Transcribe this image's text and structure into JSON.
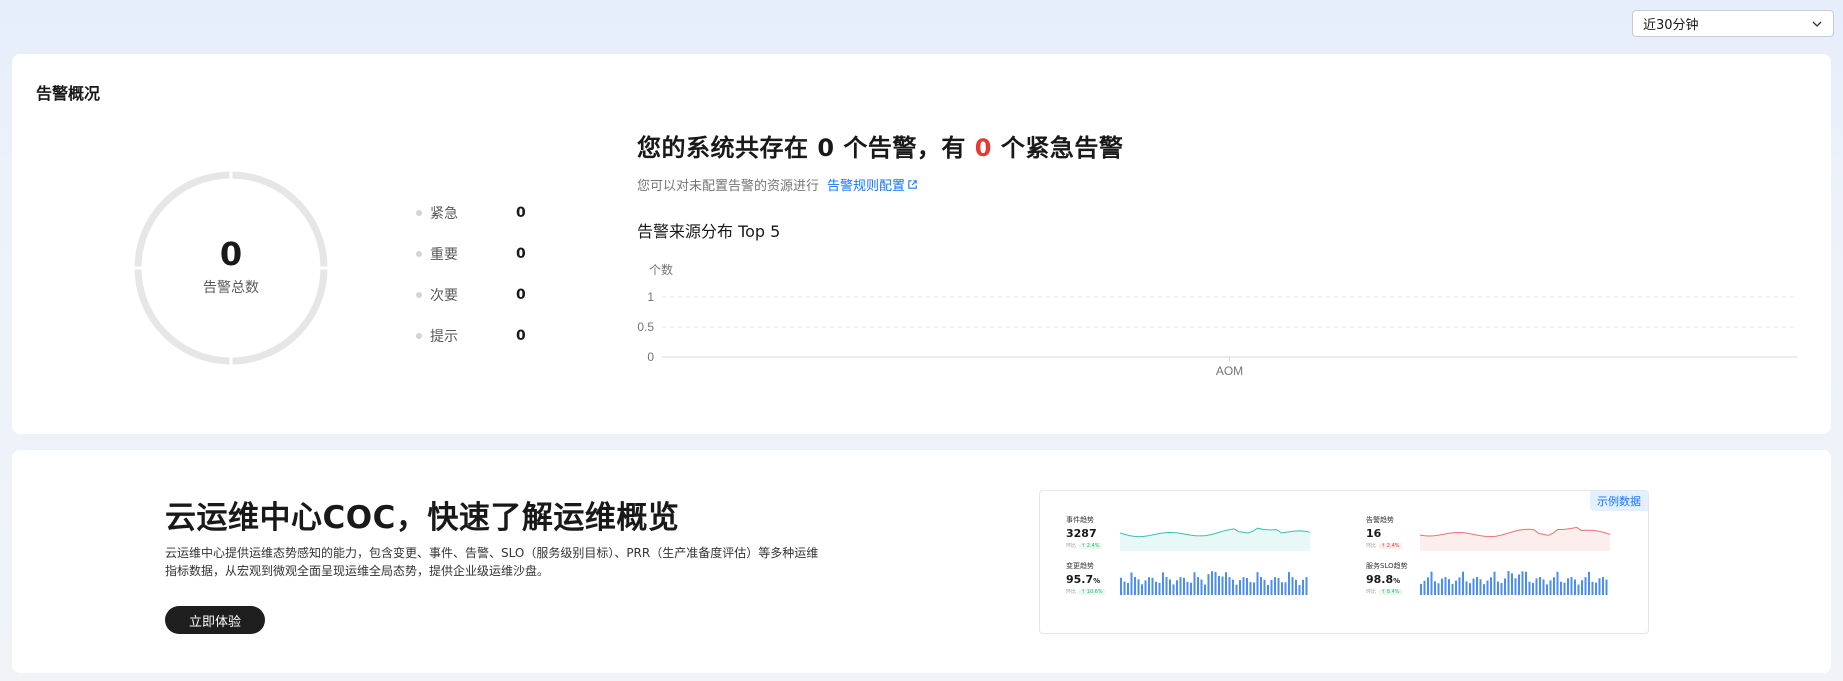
{
  "time_range": {
    "value": "近30分钟"
  },
  "alarm_overview": {
    "title": "告警概况",
    "total": {
      "value": "0",
      "label": "告警总数"
    },
    "levels": [
      {
        "label": "紧急",
        "value": "0"
      },
      {
        "label": "重要",
        "value": "0"
      },
      {
        "label": "次要",
        "value": "0"
      },
      {
        "label": "提示",
        "value": "0"
      }
    ],
    "headline": {
      "part1": "您的系统共存在 ",
      "count": "0",
      "part2": " 个告警，有 ",
      "urgent": "0",
      "part3": " 个紧急告警"
    },
    "subline": {
      "text": "您可以对未配置告警的资源进行",
      "link": "告警规则配置"
    },
    "top5_title": "告警来源分布 Top 5"
  },
  "chart_data": {
    "type": "bar",
    "ylabel": "个数",
    "yticks": [
      "1",
      "0.5",
      "0"
    ],
    "categories": [
      "AOM"
    ],
    "values": [
      0
    ],
    "ylim": [
      0,
      1
    ],
    "grid": true
  },
  "promo": {
    "title": "云运维中心COC，快速了解运维概览",
    "desc_line1": "云运维中心提供运维态势感知的能力，包含变更、事件、告警、SLO（服务级别目标）、PRR（生产准备度评估）等多种运维",
    "desc_line2": "指标数据，从宏观到微观全面呈现运维全局态势，提供企业级运维沙盘。",
    "button": "立即体验",
    "sample_tag": "示例数据",
    "minis": [
      {
        "title": "事件趋势",
        "value": "3287",
        "unit": "",
        "sub": "环比",
        "tag": "↑ 2.4%",
        "color": "#36c2b4"
      },
      {
        "title": "告警趋势",
        "value": "16",
        "unit": "",
        "sub": "环比",
        "tag": "↑ 2.4%",
        "color": "#f07070"
      },
      {
        "title": "变更趋势",
        "value": "95.7",
        "unit": "%",
        "sub": "环比",
        "tag": "↑ 10.6%",
        "color": "#4a8ef0"
      },
      {
        "title": "服务SLO趋势",
        "value": "98.8",
        "unit": "%",
        "sub": "环比",
        "tag": "↑ 8.4%",
        "color": "#4a8ef0"
      }
    ]
  }
}
